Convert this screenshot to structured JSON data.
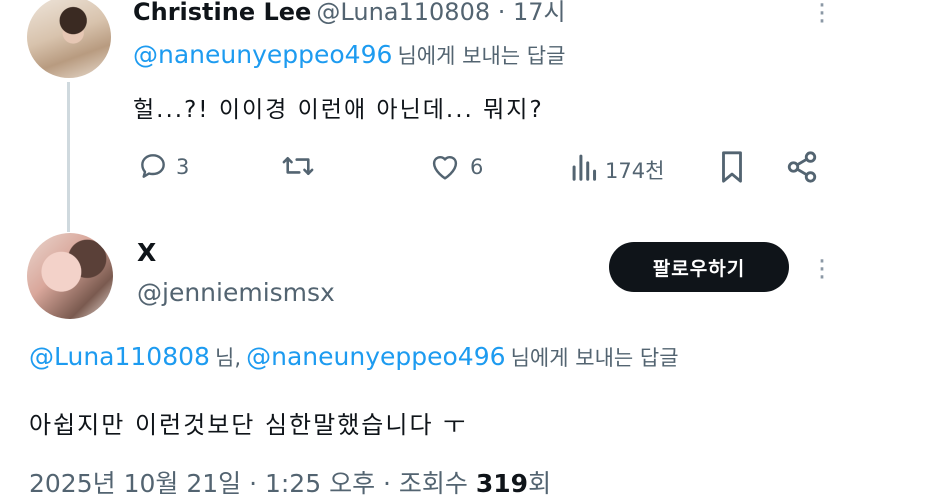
{
  "tweet1": {
    "display_name": "Christine Lee",
    "handle_time": "@Luna110808 · 17시",
    "reply_to_mention": "@naneunyeppeo496",
    "reply_to_suffix": "님에게 보내는 답글",
    "text": "헐...?! 이이경 이런애 아닌데... 뭐지?",
    "actions": {
      "reply_count": "3",
      "like_count": "6",
      "views_count": "174천"
    }
  },
  "tweet2": {
    "display_name": "X",
    "handle": "@jenniemismsx",
    "follow_label": "팔로우하기",
    "reply_mention_1": "@Luna110808",
    "reply_separator": "님,",
    "reply_mention_2": "@naneunyeppeo496",
    "reply_to_suffix": "님에게 보내는 답글",
    "text": "아쉽지만 이런것보단 심한말했습니다 ㅜ",
    "meta_date": "2025년 10월 21일 · 1:25 오후 · 조회수",
    "meta_views": "319",
    "meta_views_suffix": "회"
  },
  "icons": {
    "reply": "reply-icon",
    "retweet": "retweet-icon",
    "like": "heart-icon",
    "views": "views-icon",
    "bookmark": "bookmark-icon",
    "share": "share-icon",
    "more": "more-icon"
  },
  "colors": {
    "link": "#1d9bf0",
    "muted": "#536471",
    "text": "#0f1419",
    "button_bg": "#0f1419"
  }
}
